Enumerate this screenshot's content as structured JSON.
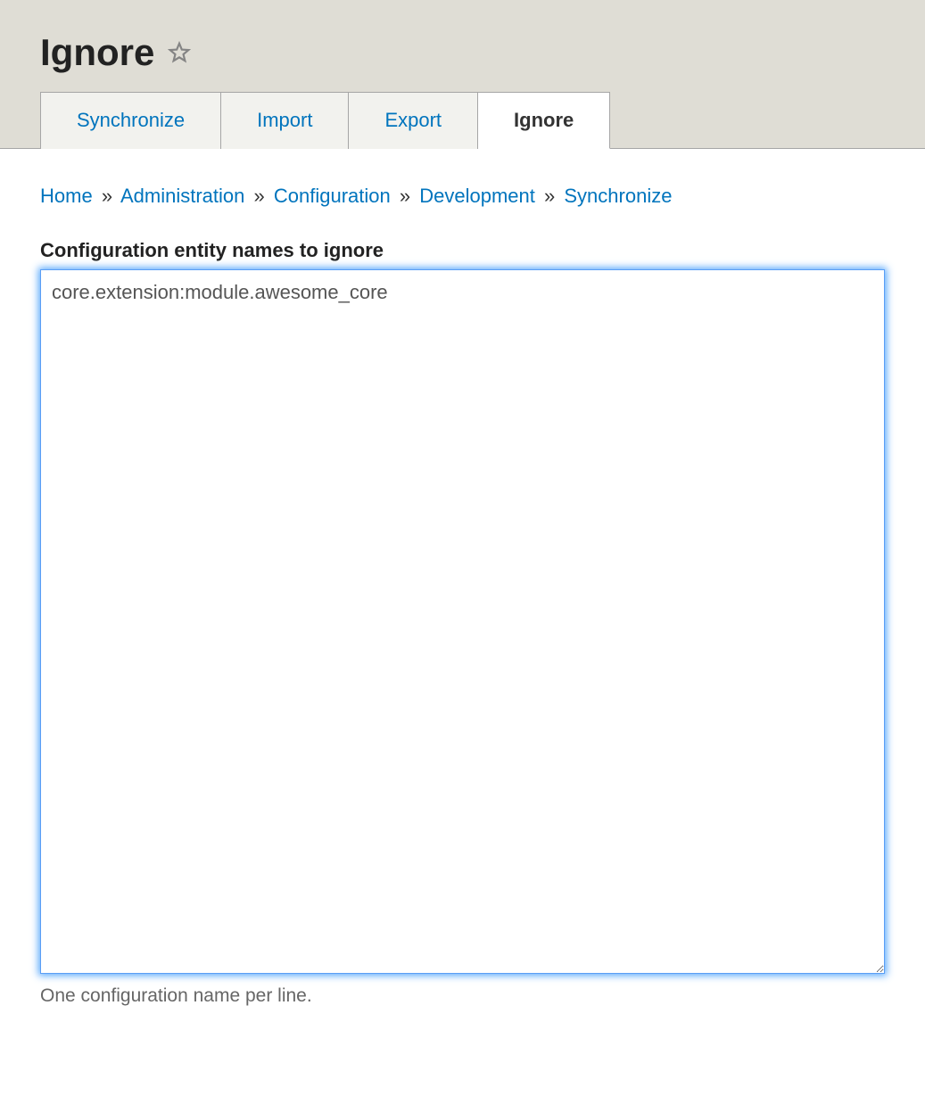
{
  "page": {
    "title": "Ignore"
  },
  "tabs": [
    {
      "label": "Synchronize",
      "active": false
    },
    {
      "label": "Import",
      "active": false
    },
    {
      "label": "Export",
      "active": false
    },
    {
      "label": "Ignore",
      "active": true
    }
  ],
  "breadcrumb": {
    "items": [
      {
        "label": "Home"
      },
      {
        "label": "Administration"
      },
      {
        "label": "Configuration"
      },
      {
        "label": "Development"
      },
      {
        "label": "Synchronize"
      }
    ],
    "separator": "»"
  },
  "form": {
    "field_label": "Configuration entity names to ignore",
    "textarea_value": "core.extension:module.awesome_core",
    "help_text": "One configuration name per line."
  }
}
